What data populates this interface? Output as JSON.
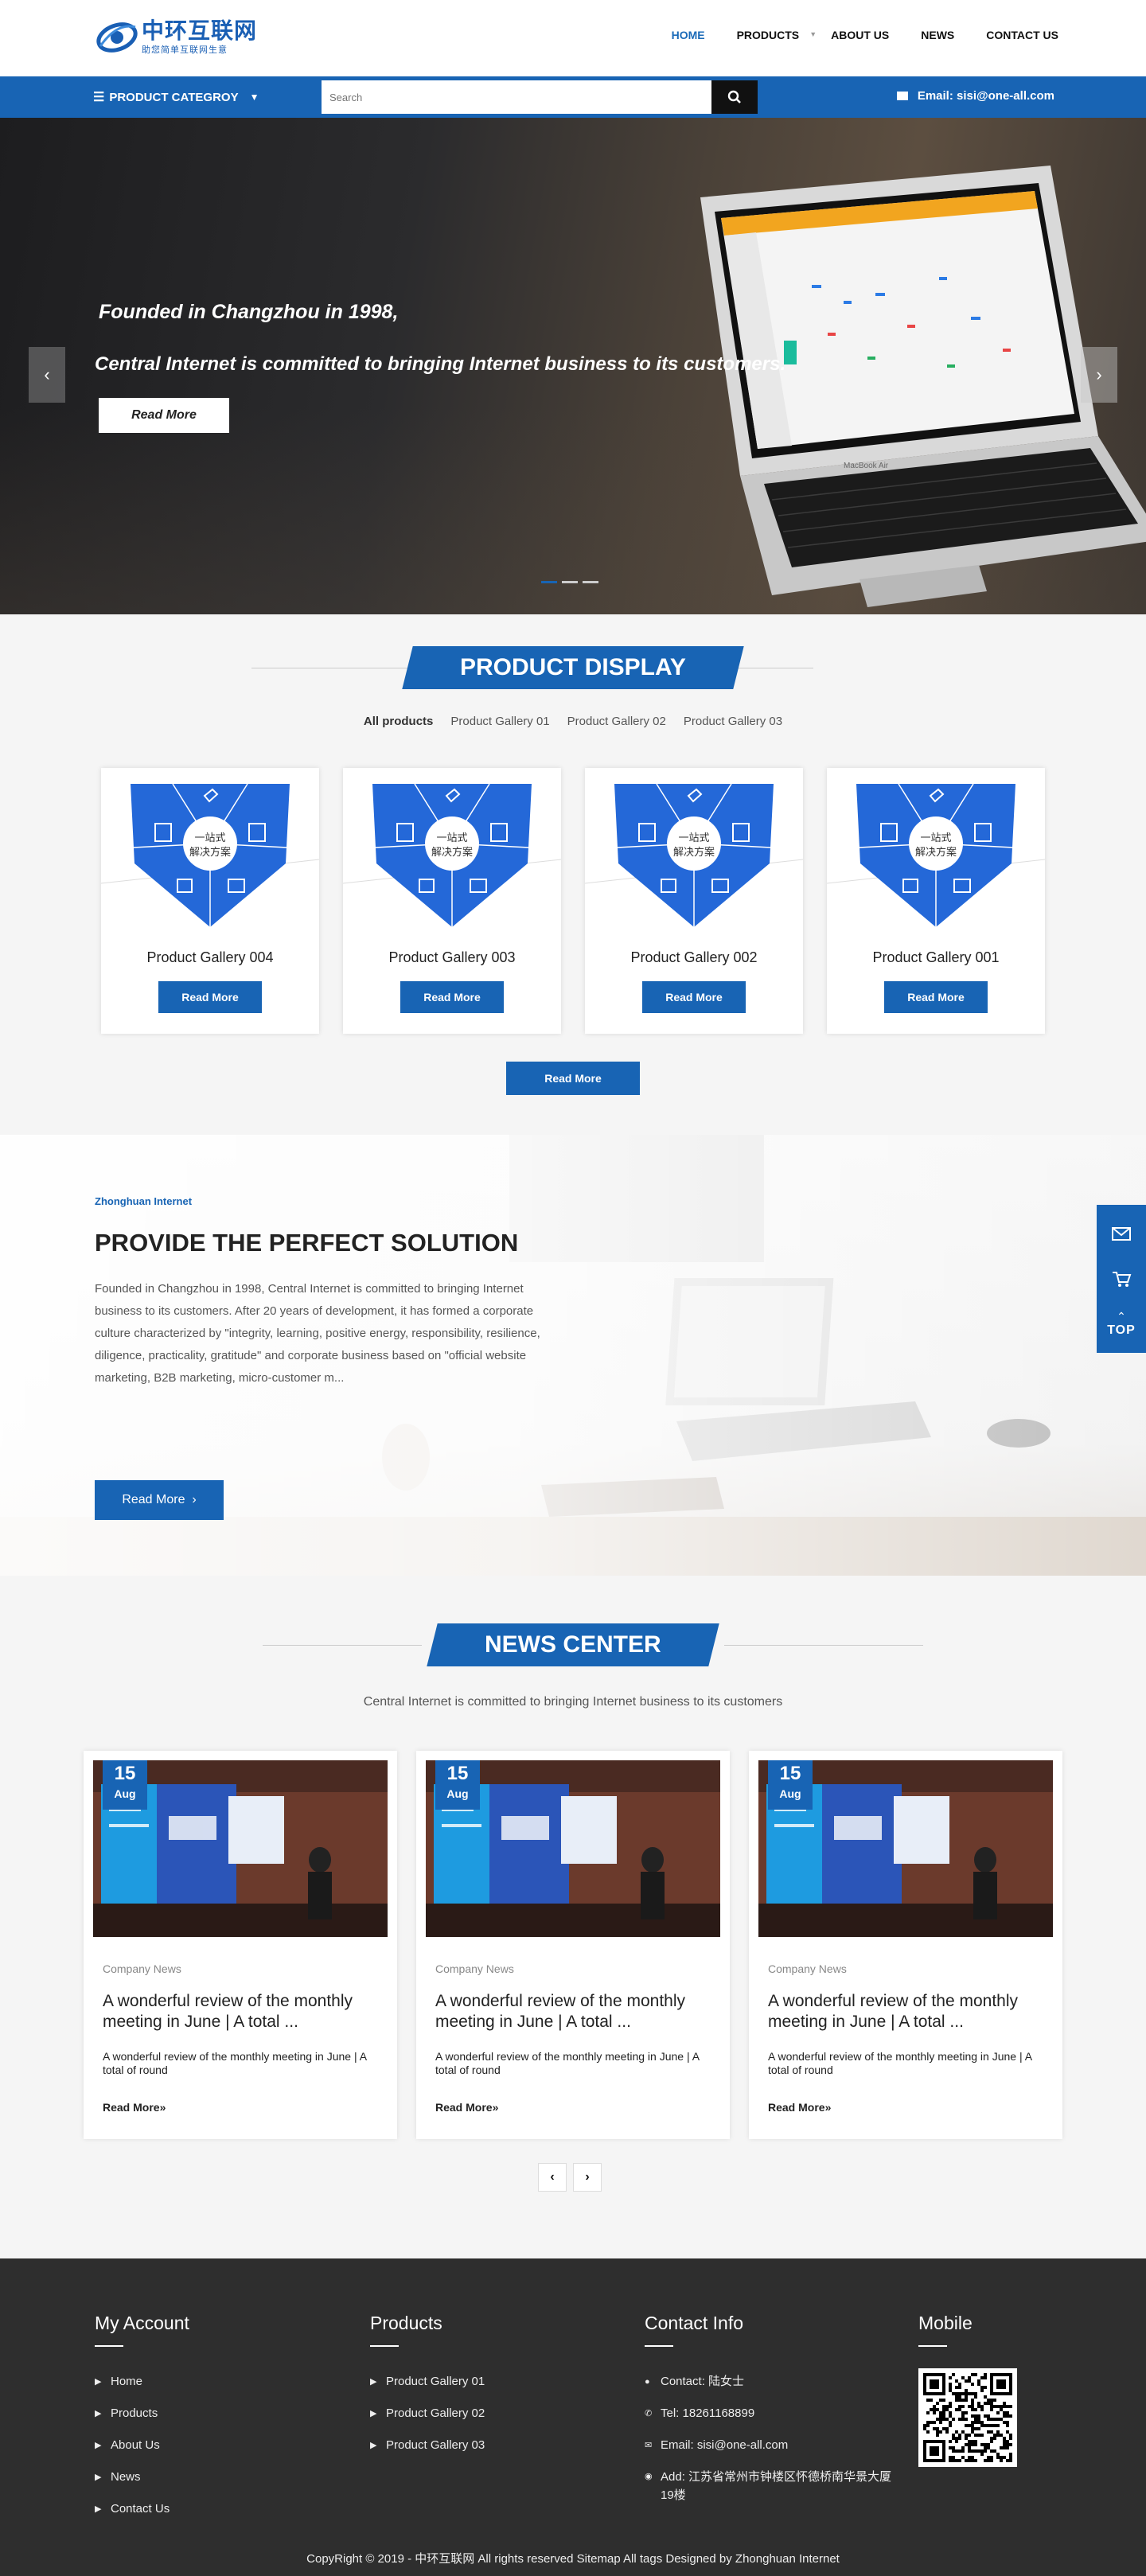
{
  "header": {
    "logo_text": "中环互联网",
    "logo_sub": "助您简单互联网生意",
    "nav": [
      {
        "label": "HOME",
        "active": true
      },
      {
        "label": "PRODUCTS"
      },
      {
        "label": "ABOUT US"
      },
      {
        "label": "NEWS"
      },
      {
        "label": "CONTACT US"
      }
    ]
  },
  "bar": {
    "category_label": "PRODUCT CATEGROY",
    "search_placeholder": "Search",
    "email_label": "Email: sisi@one-all.com"
  },
  "hero": {
    "line1": "Founded in Changzhou in 1998,",
    "line2": "Central Internet is committed to bringing Internet business to its customers.",
    "read_more": "Read More",
    "screen_caption": "MacBook Air"
  },
  "product_display": {
    "title": "PRODUCT DISPLAY",
    "tabs": [
      "All products",
      "Product Gallery 01",
      "Product Gallery 02",
      "Product Gallery 03"
    ],
    "card_badge": [
      "一站式",
      "解决方案"
    ],
    "cards": [
      {
        "name": "Product Gallery 004",
        "btn": "Read More"
      },
      {
        "name": "Product Gallery 003",
        "btn": "Read More"
      },
      {
        "name": "Product Gallery 002",
        "btn": "Read More"
      },
      {
        "name": "Product Gallery 001",
        "btn": "Read More"
      }
    ],
    "more": "Read More"
  },
  "solution": {
    "tag": "Zhonghuan Internet",
    "title": "PROVIDE THE PERFECT SOLUTION",
    "text": "Founded in Changzhou in 1998, Central Internet is committed to bringing Internet business to its customers. After 20 years of development, it has formed a corporate culture characterized by \"integrity, learning, positive energy, responsibility, resilience, diligence, practicality, gratitude\" and corporate business based on \"official website marketing, B2B marketing, micro-customer m...",
    "read_more": "Read More"
  },
  "news": {
    "title": "NEWS CENTER",
    "intro": "Central Internet is committed to bringing Internet business to its customers",
    "items": [
      {
        "day": "15",
        "month": "Aug",
        "category": "Company News",
        "title": "A wonderful review of the monthly meeting in June | A total ...",
        "desc": "A wonderful review of the monthly meeting in June | A total of round",
        "more": "Read More»"
      },
      {
        "day": "15",
        "month": "Aug",
        "category": "Company News",
        "title": "A wonderful review of the monthly meeting in June | A total ...",
        "desc": "A wonderful review of the monthly meeting in June | A total of round",
        "more": "Read More»"
      },
      {
        "day": "15",
        "month": "Aug",
        "category": "Company News",
        "title": "A wonderful review of the monthly meeting in June | A total ...",
        "desc": "A wonderful review of the monthly meeting in June | A total of round",
        "more": "Read More»"
      }
    ],
    "prev": "‹",
    "next": "›"
  },
  "footer": {
    "account": {
      "title": "My Account",
      "links": [
        "Home",
        "Products",
        "About Us",
        "News",
        "Contact Us"
      ]
    },
    "products": {
      "title": "Products",
      "links": [
        "Product Gallery 01",
        "Product Gallery 02",
        "Product Gallery 03"
      ]
    },
    "contact": {
      "title": "Contact Info",
      "contact": "Contact: 陆女士",
      "tel": "Tel: 18261168899",
      "email": "Email: sisi@one-all.com",
      "addr": "Add: 江苏省常州市钟楼区怀德桥南华景大厦19楼"
    },
    "mobile": {
      "title": "Mobile"
    },
    "copyright": "CopyRight © 2019 -   中环互联网  All rights reserved Sitemap  All tags   Designed by Zhonghuan Internet"
  },
  "float": {
    "top_label": "TOP"
  },
  "colors": {
    "brand": "#1864b4",
    "footer": "#2e2e2e"
  }
}
